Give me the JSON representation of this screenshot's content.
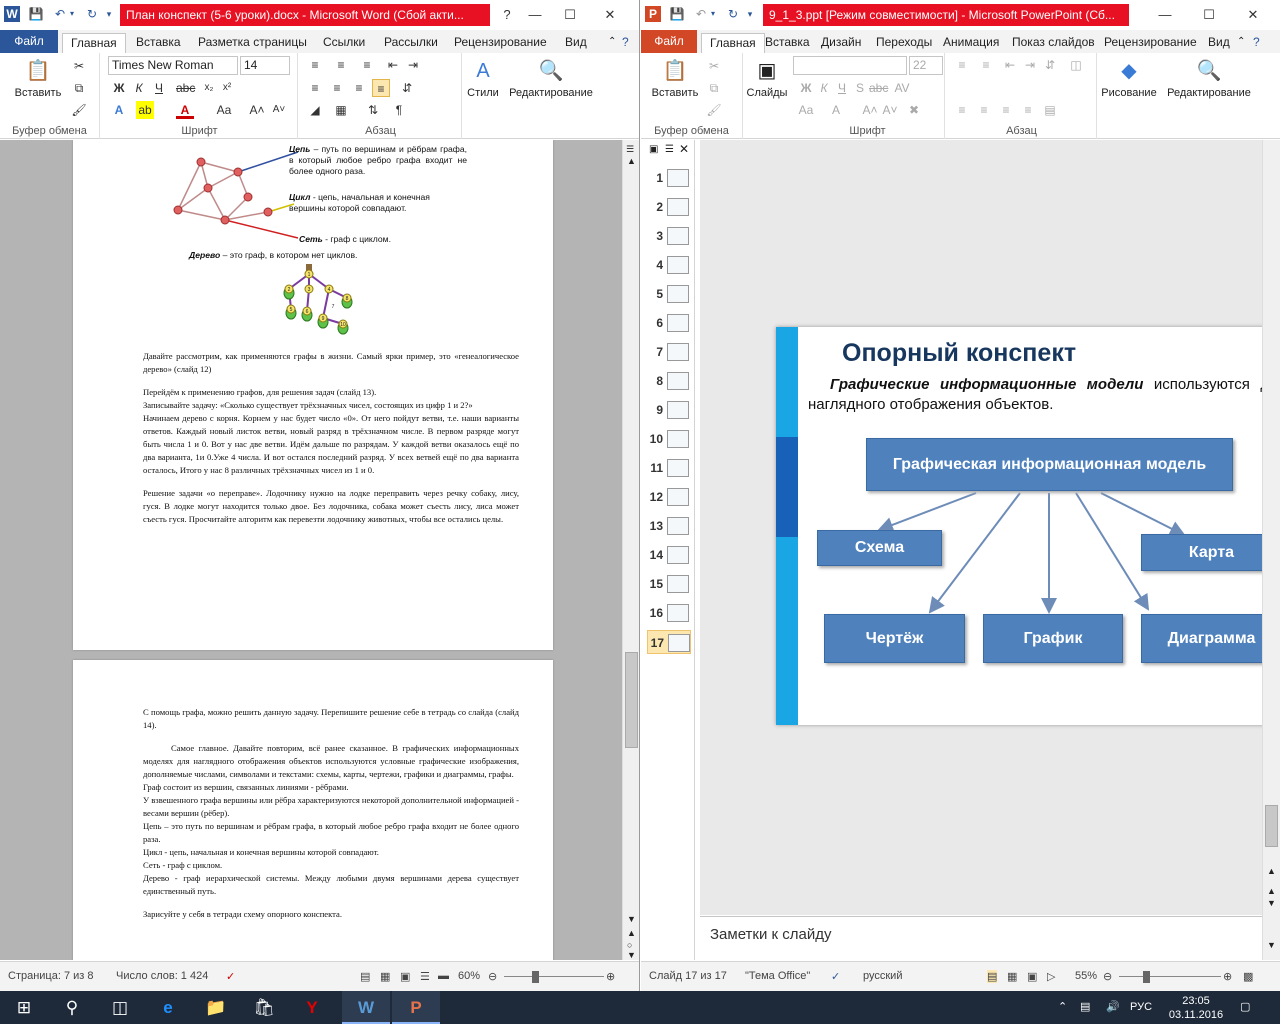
{
  "word": {
    "title": "План конспект (5-6 уроки).docx - Microsoft Word (Сбой акти...",
    "file_tab": "Файл",
    "tabs": [
      "Главная",
      "Вставка",
      "Разметка страницы",
      "Ссылки",
      "Рассылки",
      "Рецензирование",
      "Вид"
    ],
    "font_name": "Times New Roman",
    "font_size": "14",
    "btn_paste": "Вставить",
    "btn_styles": "Стили",
    "btn_edit": "Редактирование",
    "groups": {
      "clipboard": "Буфер обмена",
      "font": "Шрифт",
      "paragraph": "Абзац"
    },
    "graph_labels": {
      "chain_term": "Цепь",
      "chain_text": " – путь по вершинам и рёбрам графа, в который любое ребро графа входит не более одного раза.",
      "cycle_term": "Цикл",
      "cycle_text": " - цепь, начальная и конечная вершины которой совпадают.",
      "net_term": "Сеть",
      "net_text": " - граф с циклом.",
      "tree_term": "Дерево",
      "tree_text": " – это граф, в котором нет циклов."
    },
    "tree_nodes": [
      "1",
      "2",
      "3",
      "4",
      "5",
      "6",
      "7",
      "8",
      "9",
      "10"
    ],
    "page1_paragraphs": [
      "Давайте рассмотрим, как применяются графы в жизни. Самый ярки пример, это «генеалогическое дерево» (слайд 12)",
      "Перейдём к применению графов, для решения задач (слайд 13).",
      "Записывайте задачу: «Сколько существует трёхзначных чисел, состоящих из цифр 1 и 2?»",
      "Начинаем дерево с корня. Корнем у нас будет число «0». От него пойдут ветви, т.е. наши варианты ответов. Каждый новый листок ветви, новый разряд в трёхзначном числе. В первом разряде могут быть числа 1 и 0. Вот у нас две ветви. Идём дальше по разрядам. У каждой ветви оказалось ещё по два варианта, 1и 0.Уже 4 числа. И вот остался последний разряд. У всех ветвей ещё по два варианта осталось, Итого у нас 8 различных трёхзначных чисел из 1 и 0.",
      "Решение задачи «о переправе». Лодочнику нужно на лодке переправить через речку собаку, лису, гуся. В лодке могут находится только двое. Без лодочника, собака может съесть лису, лиса может съесть гуся. Просчитайте алгоритм как перевезти лодочнику животных, чтобы все остались целы."
    ],
    "page2_paragraphs": [
      "С помощь графа, можно решить данную задачу. Перепишите решение себе в тетрадь со слайда (слайд 14).",
      "Самое главное. Давайте повторим, всё ранее сказанное. В графических информационных моделях для наглядного отображения объектов используются условные графические изображения, дополняемые числами, символами и текстами: схемы, карты, чертежи, графики и диаграммы, графы.",
      "Граф состоит из вершин, связанных линиями - рёбрами.",
      "У взвешенного графа вершины или рёбра характеризуются некоторой дополнительной информацией - весами вершин (рёбер).",
      "Цепь – это путь по вершинам и рёбрам графа, в который любое ребро графа входит не более одного раза.",
      " Цикл - цепь, начальная и конечная вершины которой совпадают.",
      " Сеть - граф с циклом.",
      "Дерево - граф иерархической системы. Между любыми двумя вершинами дерева существует единственный путь.",
      "Зарисуйте у себя в тетради схему опорного конспекта."
    ],
    "status": {
      "page": "Страница: 7 из 8",
      "words": "Число слов: 1 424",
      "zoom": "60%"
    }
  },
  "ppt": {
    "title": "9_1_3.ppt [Режим совместимости] - Microsoft PowerPoint (Сб...",
    "file_tab": "Файл",
    "tabs": [
      "Главная",
      "Вставка",
      "Дизайн",
      "Переходы",
      "Анимация",
      "Показ слайдов",
      "Рецензирование",
      "Вид"
    ],
    "font_size": "22",
    "btn_paste": "Вставить",
    "btn_slides": "Слайды",
    "btn_draw": "Рисование",
    "btn_edit": "Редактирование",
    "groups": {
      "clipboard": "Буфер обмена",
      "font": "Шрифт",
      "paragraph": "Абзац"
    },
    "thumb_numbers": [
      "1",
      "2",
      "3",
      "4",
      "5",
      "6",
      "7",
      "8",
      "9",
      "10",
      "11",
      "12",
      "13",
      "14",
      "15",
      "16",
      "17"
    ],
    "slide": {
      "title": "Опорный конспект",
      "subtitle_em": "Графические информационные модели",
      "subtitle_rest": " используются для наглядного отображения объектов.",
      "root": "Графическая информационная модель",
      "boxes": [
        "Схема",
        "Карта",
        "Чертёж",
        "График",
        "Диаграмма"
      ]
    },
    "notes_placeholder": "Заметки к слайду",
    "status": {
      "slide": "Слайд 17 из 17",
      "theme": "\"Тема Office\"",
      "lang": "русский",
      "zoom": "55%"
    }
  },
  "taskbar": {
    "lang": "РУС",
    "time": "23:05",
    "date": "03.11.2016"
  },
  "colors": {
    "word_blue": "#2b579a",
    "ppt_orange": "#d24726",
    "title_red": "#e81123",
    "smartart_blue": "#4f81bd"
  }
}
